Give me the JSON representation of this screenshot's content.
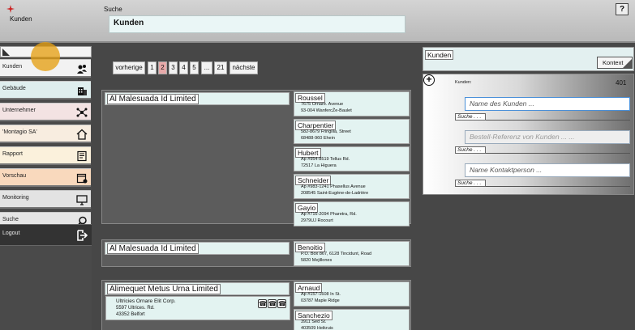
{
  "header": {
    "app_name": "Kunden",
    "search_caption": "Suche",
    "search_value": "Kunden",
    "help_label": "?"
  },
  "sidebar": {
    "items": [
      {
        "label": "Kunden",
        "icon": "users-icon",
        "color": "#f2f2f2"
      },
      {
        "label": "Gebäude",
        "icon": "building-icon",
        "color": "#dfeeee"
      },
      {
        "label": "Unternehmer",
        "icon": "network-icon",
        "color": "#f3e3e3"
      },
      {
        "label": "'Montagio SA'",
        "icon": "home-icon",
        "color": "#f8ede0"
      },
      {
        "label": "Rapport",
        "icon": "report-icon",
        "color": "#fbf1dc"
      },
      {
        "label": "Vorschau",
        "icon": "calendar-icon",
        "color": "#f9d9bd"
      },
      {
        "label": "Monitoring",
        "icon": "monitor-icon",
        "color": "#e3e3e3"
      },
      {
        "label": "Suche",
        "icon": "search-icon",
        "color": "#e6e6e6"
      }
    ],
    "logout_label": "Logout"
  },
  "pagination": {
    "prev": "vorherige",
    "pages": [
      "1",
      "2",
      "3",
      "4",
      "5",
      "...",
      "21"
    ],
    "current": "2",
    "next": "nächste"
  },
  "cards": [
    {
      "name": "Al Malesuada Id Limited",
      "entries": [
        {
          "name": "Roussel",
          "line1": "7675 Ornare. Avenue",
          "line2": "93-004 WanfercŽe-Baulet"
        },
        {
          "name": "Charpentier",
          "line1": "582-8679 Fringilla, Street",
          "line2": "68488-960 Ehein"
        },
        {
          "name": "Hubert",
          "line1": "Ap #954-8519 Tellus Rd.",
          "line2": "72517 La Higuera"
        },
        {
          "name": "Schneider",
          "line1": "Ap #983-1241 Phasellus Avenue",
          "line2": "208545 Saint-Eugène-de-Ladrière"
        },
        {
          "name": "Gayio",
          "line1": "Ap #716-2094 Pharetra, Rd.",
          "line2": "2979UJ Rocourt"
        }
      ]
    },
    {
      "name": "Al Malesuada Id Limited",
      "entries": [
        {
          "name": "Benoitio",
          "line1": "P.O. Box 867, 6128 Tincidunt, Road",
          "line2": "5820 Mejillones"
        }
      ]
    },
    {
      "name": "Alimequet Metus Urna Limited",
      "detail": {
        "line1": "Ultricies Ornare Elit Corp.",
        "line2": "5597 Ultrices. Rd.",
        "line3": "43352 Belfort"
      },
      "entries": [
        {
          "name": "Arnaud",
          "line1": "Ap #157-1608 In St.",
          "line2": "03787 Maple Ridge"
        },
        {
          "name": "Sanchezio",
          "line1": "3911 Sed St.",
          "line2": "403509 Heikruis"
        }
      ]
    }
  ],
  "right_panel": {
    "title": "Kunden",
    "kontext_label": "Kontext",
    "kunden_label": "Kunden:",
    "count": "401",
    "filters": [
      {
        "placeholder": "Name des Kunden ...",
        "button": "Suche . . ."
      },
      {
        "placeholder": "Bestell-Referenz von Kunden ... ...",
        "button": "Suche . . ."
      },
      {
        "placeholder": "Name Kontaktperson ...",
        "button": "Suche . . ."
      }
    ]
  }
}
